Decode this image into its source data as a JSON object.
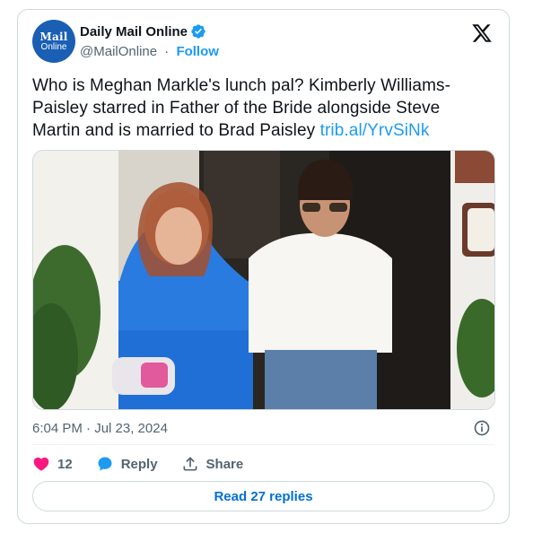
{
  "author": {
    "avatar_line1": "Mail",
    "avatar_line2": "Online",
    "name": "Daily Mail Online",
    "handle": "@MailOnline",
    "separator": "·",
    "follow_label": "Follow"
  },
  "tweet": {
    "text": "Who is Meghan Markle's lunch pal? Kimberly Williams-Paisley starred in Father of the Bride alongside Steve Martin and is married to Brad Paisley",
    "link_text": "trib.al/YrvSiNk",
    "timestamp": "6:04 PM · Jul 23, 2024"
  },
  "actions": {
    "likes_count": "12",
    "reply_label": "Reply",
    "share_label": "Share"
  },
  "footer": {
    "read_replies_label": "Read 27 replies"
  },
  "colors": {
    "accent": "#1d9bf0",
    "like": "#f91880",
    "avatar_bg": "#1a5fb4"
  }
}
